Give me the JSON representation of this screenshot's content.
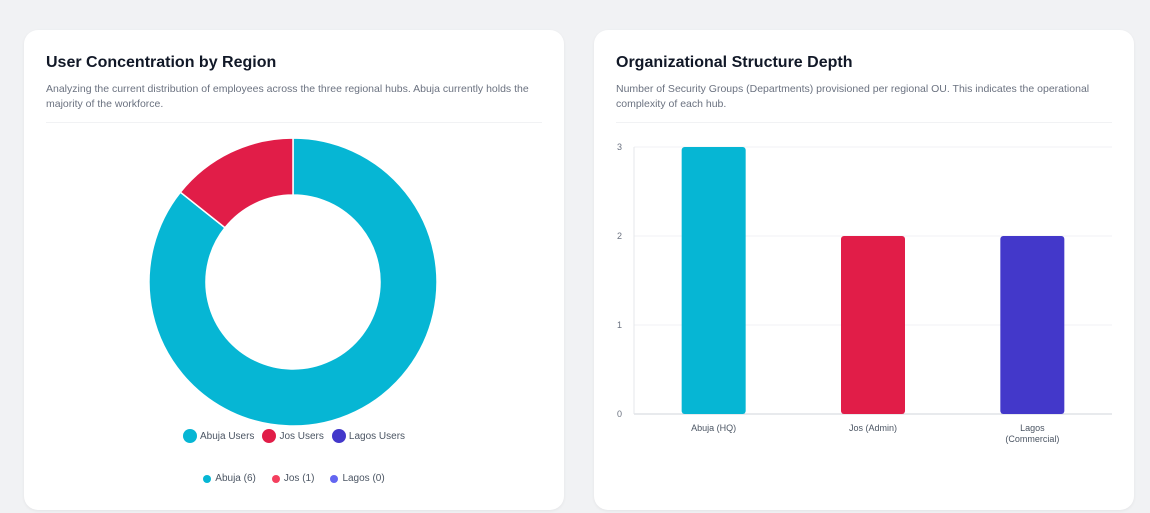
{
  "donut_card": {
    "title": "User Concentration by Region",
    "description": "Analyzing the current distribution of employees across the three regional hubs. Abuja currently holds the majority of the workforce."
  },
  "bar_card": {
    "title": "Organizational Structure Depth",
    "description": "Number of Security Groups (Departments) provisioned per regional OU. This indicates the operational complexity of each hub."
  },
  "colors": {
    "abuja": "#06b6d4",
    "jos": "#e11d48",
    "lagos": "#4338ca",
    "lagos_light": "#6366f1",
    "jos_light": "#f43f5e"
  },
  "chart_data": [
    {
      "type": "pie",
      "variant": "donut",
      "title": "User Concentration by Region",
      "categories": [
        "Abuja Users",
        "Jos Users",
        "Lagos Users"
      ],
      "values": [
        6,
        1,
        0
      ],
      "legend_primary": [
        "Abuja Users",
        "Jos Users",
        "Lagos Users"
      ],
      "legend_secondary": [
        "Abuja (6)",
        "Jos (1)",
        "Lagos (0)"
      ],
      "legend_placement": "bottom"
    },
    {
      "type": "bar",
      "title": "Organizational Structure Depth",
      "categories": [
        "Abuja (HQ)",
        "Jos (Admin)",
        "Lagos (Commercial)"
      ],
      "category_lines": [
        [
          "Abuja (HQ)"
        ],
        [
          "Jos (Admin)"
        ],
        [
          "Lagos",
          "(Commercial)"
        ]
      ],
      "values": [
        3,
        2,
        2
      ],
      "ylim": [
        0,
        3
      ],
      "yticks": [
        "0",
        "1",
        "2",
        "3"
      ],
      "grid": true,
      "xlabel": "",
      "ylabel": ""
    }
  ]
}
